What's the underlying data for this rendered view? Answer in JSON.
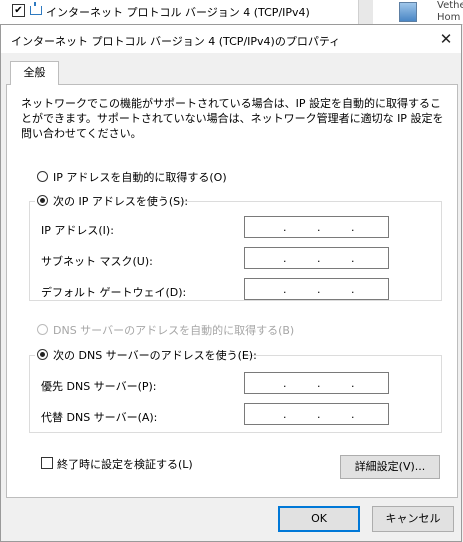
{
  "background": {
    "item_label": "インターネット プロトコル バージョン 4 (TCP/IPv4)",
    "right_text_1": "Vethe",
    "right_text_2": "Hom",
    "check_mark": "✔"
  },
  "dialog": {
    "title": "インターネット プロトコル バージョン 4 (TCP/IPv4)のプロパティ",
    "close": "✕",
    "tab_general": "全般",
    "description": "ネットワークでこの機能がサポートされている場合は、IP 設定を自動的に取得することができます。サポートされていない場合は、ネットワーク管理者に適切な IP 設定を問い合わせてください。",
    "ip_auto_label": "IP アドレスを自動的に取得する(O)",
    "ip_manual_label": "次の IP アドレスを使う(S):",
    "ip_address_label": "IP アドレス(I):",
    "subnet_label": "サブネット マスク(U):",
    "gateway_label": "デフォルト ゲートウェイ(D):",
    "dns_auto_label": "DNS サーバーのアドレスを自動的に取得する(B)",
    "dns_manual_label": "次の DNS サーバーのアドレスを使う(E):",
    "dns_preferred_label": "優先 DNS サーバー(P):",
    "dns_alternate_label": "代替 DNS サーバー(A):",
    "validate_label": "終了時に設定を検証する(L)",
    "advanced_button": "詳細設定(V)...",
    "ok_button": "OK",
    "cancel_button": "キャンセル",
    "ip_dot": "."
  }
}
